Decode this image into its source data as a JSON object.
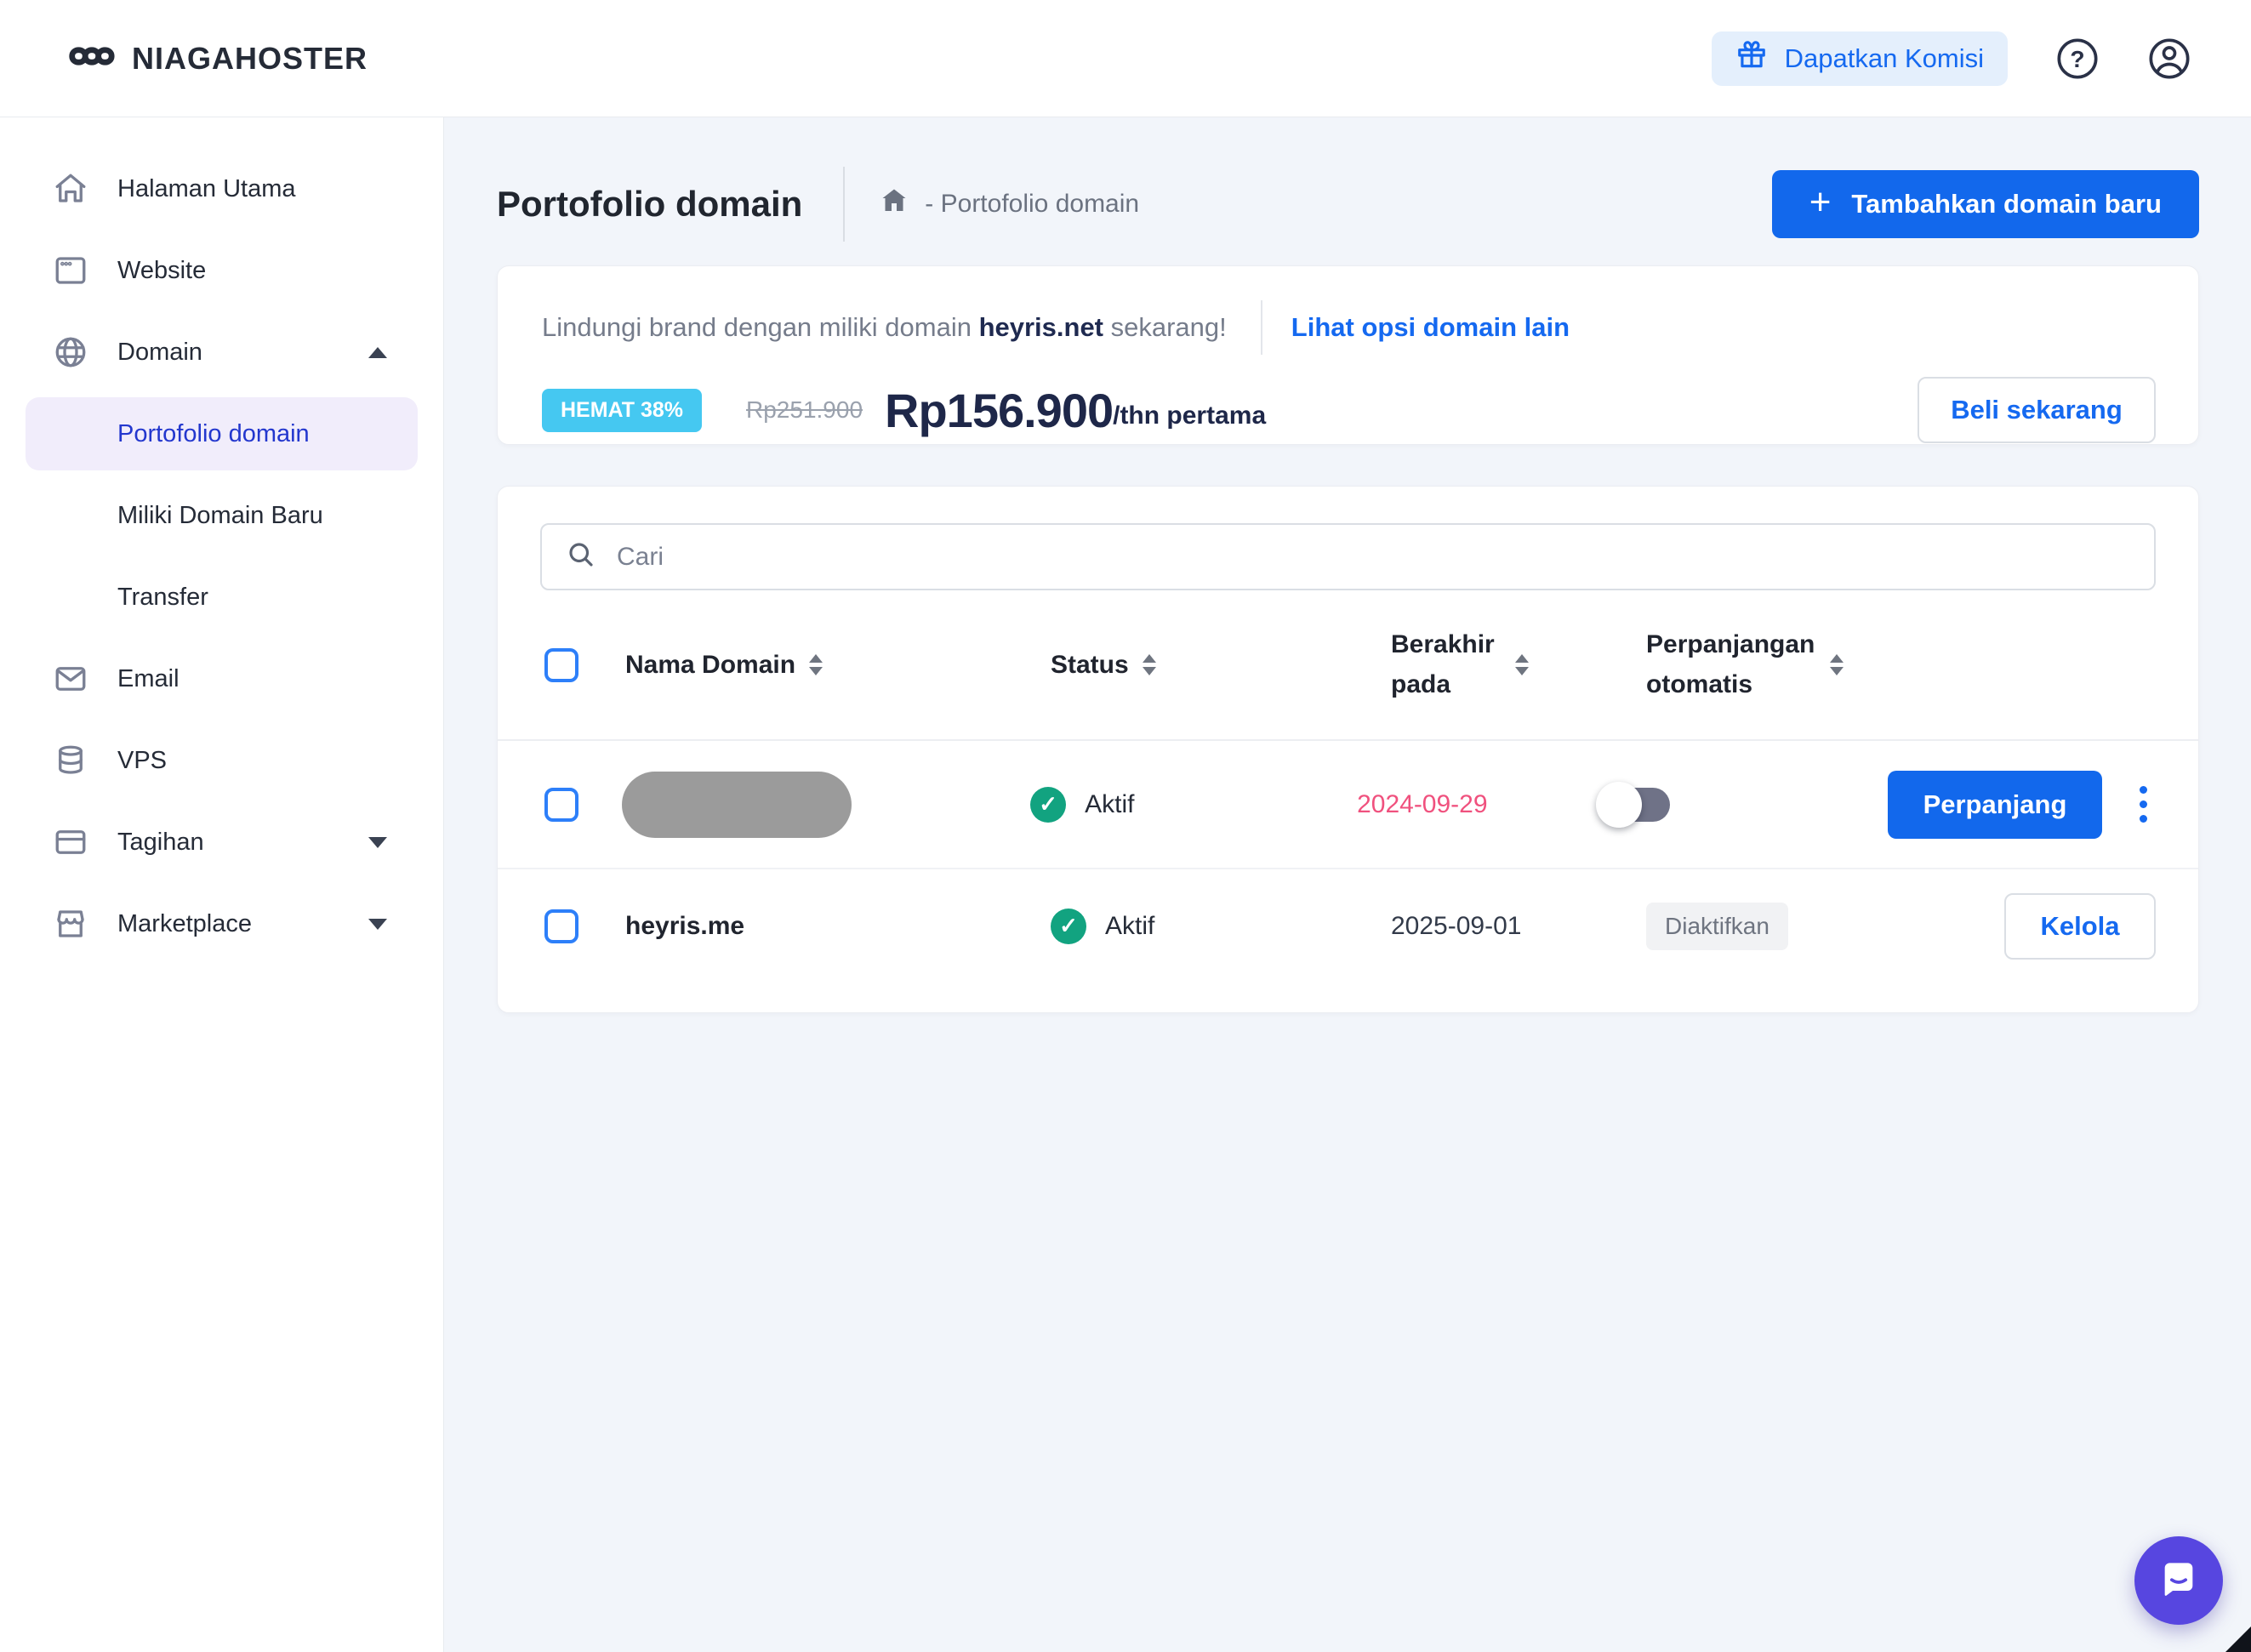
{
  "topbar": {
    "brand": "NIAGAHOSTER",
    "commission_label": "Dapatkan Komisi",
    "help_icon": "question-mark-icon",
    "account_icon": "user-circle-icon"
  },
  "sidebar": {
    "items": [
      {
        "label": "Halaman Utama",
        "icon": "home-icon"
      },
      {
        "label": "Website",
        "icon": "browser-icon"
      },
      {
        "label": "Domain",
        "icon": "globe-icon",
        "expanded": true
      },
      {
        "label": "Portofolio domain",
        "active": true
      },
      {
        "label": "Miliki Domain Baru"
      },
      {
        "label": "Transfer"
      },
      {
        "label": "Email",
        "icon": "envelope-icon"
      },
      {
        "label": "VPS",
        "icon": "database-icon"
      },
      {
        "label": "Tagihan",
        "icon": "credit-card-icon",
        "expanded": false
      },
      {
        "label": "Marketplace",
        "icon": "storefront-icon",
        "expanded": false
      }
    ]
  },
  "page": {
    "title": "Portofolio domain",
    "breadcrumb": "- Portofolio domain",
    "add_button": "Tambahkan domain baru",
    "plus_glyph": "+"
  },
  "promo": {
    "message_prefix": "Lindungi brand dengan miliki domain ",
    "domain": "heyris.net",
    "message_suffix": " sekarang!",
    "link": "Lihat opsi domain lain",
    "save_badge": "HEMAT 38%",
    "old_price": "Rp251.900",
    "new_price": "Rp156.900",
    "price_suffix": "/thn pertama",
    "buy_button": "Beli sekarang"
  },
  "search": {
    "placeholder": "Cari"
  },
  "table": {
    "headers": [
      "Nama Domain",
      "Status",
      "Berakhir pada",
      "Perpanjangan otomatis"
    ],
    "rows": [
      {
        "domain_redacted": true,
        "status": "Aktif",
        "status_glyph": "✓",
        "expires": "2024-09-29",
        "autorenew_state": "off",
        "action": "Perpanjang"
      },
      {
        "domain": "heyris.me",
        "status": "Aktif",
        "status_glyph": "✓",
        "expires": "2025-09-01",
        "autorenew_label": "Diaktifkan",
        "action": "Kelola"
      }
    ]
  },
  "colors": {
    "primary_blue": "#1268EC",
    "link_blue": "#1569F0",
    "active_sidebar_text": "#2337CE",
    "active_sidebar_bg": "#F1EDFB",
    "save_badge_cyan": "#45C8F1",
    "status_green": "#12A380",
    "expire_pink": "#F0517E",
    "navy_price": "#1E2749",
    "chat_purple": "#5746E0",
    "main_bg": "#F2F5FA"
  }
}
